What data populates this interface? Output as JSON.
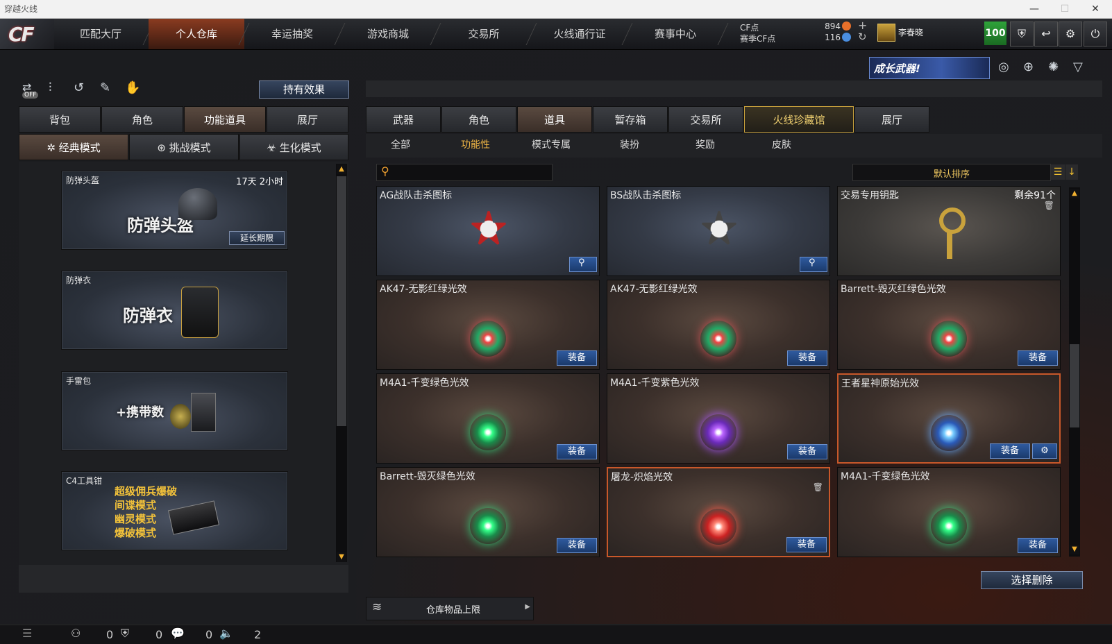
{
  "window": {
    "title": "穿越火线",
    "min": "—",
    "max": "☐",
    "close": "✕"
  },
  "nav": {
    "logo": "CF",
    "tabs": [
      "匹配大厅",
      "个人仓库",
      "幸运抽奖",
      "游戏商城",
      "交易所",
      "火线通行证",
      "赛事中心"
    ],
    "cf_label": "CF点",
    "cf_value": "894",
    "match_cf_label": "赛季CF点",
    "match_cf_value": "116",
    "username": "李春晓",
    "level": "100"
  },
  "promo": {
    "text": "成长武器!"
  },
  "left": {
    "hold_effect": "持有效果",
    "off_label": "OFF",
    "tabs": [
      "背包",
      "角色",
      "功能道具",
      "展厅"
    ],
    "modes": [
      "经典模式",
      "挑战模式",
      "生化模式"
    ],
    "cards": [
      {
        "name": "防弹头盔",
        "big": "防弹头盔",
        "time": "17天 2小时",
        "extend": "延长期限"
      },
      {
        "name": "防弹衣",
        "big": "防弹衣"
      },
      {
        "name": "手雷包",
        "big": "+携带数"
      },
      {
        "name": "C4工具钳",
        "lines": [
          "超级佣兵爆破",
          "间谍模式",
          "幽灵模式",
          "爆破模式"
        ]
      }
    ]
  },
  "right": {
    "tabs": [
      "武器",
      "角色",
      "道具",
      "暂存箱",
      "交易所",
      "火线珍藏馆",
      "展厅"
    ],
    "subtabs": [
      "全部",
      "功能性",
      "模式专属",
      "装扮",
      "奖励",
      "皮肤"
    ],
    "search_placeholder": "",
    "sort": "默认排序",
    "equip": "装备",
    "items": [
      {
        "name": "AG战队击杀图标"
      },
      {
        "name": "BS战队击杀图标"
      },
      {
        "name": "交易专用钥匙",
        "extra": "剩余91个"
      },
      {
        "name": "AK47-无影红绿光效"
      },
      {
        "name": "AK47-无影红绿光效"
      },
      {
        "name": "Barrett-毁灭红绿色光效"
      },
      {
        "name": "M4A1-千变绿色光效"
      },
      {
        "name": "M4A1-千变紫色光效"
      },
      {
        "name": "王者星神原始光效"
      },
      {
        "name": "Barrett-毁灭绿色光效"
      },
      {
        "name": "屠龙-炽焰光效"
      },
      {
        "name": "M4A1-千变绿色光效"
      }
    ],
    "select_delete": "选择删除",
    "storage_limit": "仓库物品上限"
  },
  "bottom": {
    "counts": [
      "0",
      "0",
      "0",
      "2"
    ]
  }
}
